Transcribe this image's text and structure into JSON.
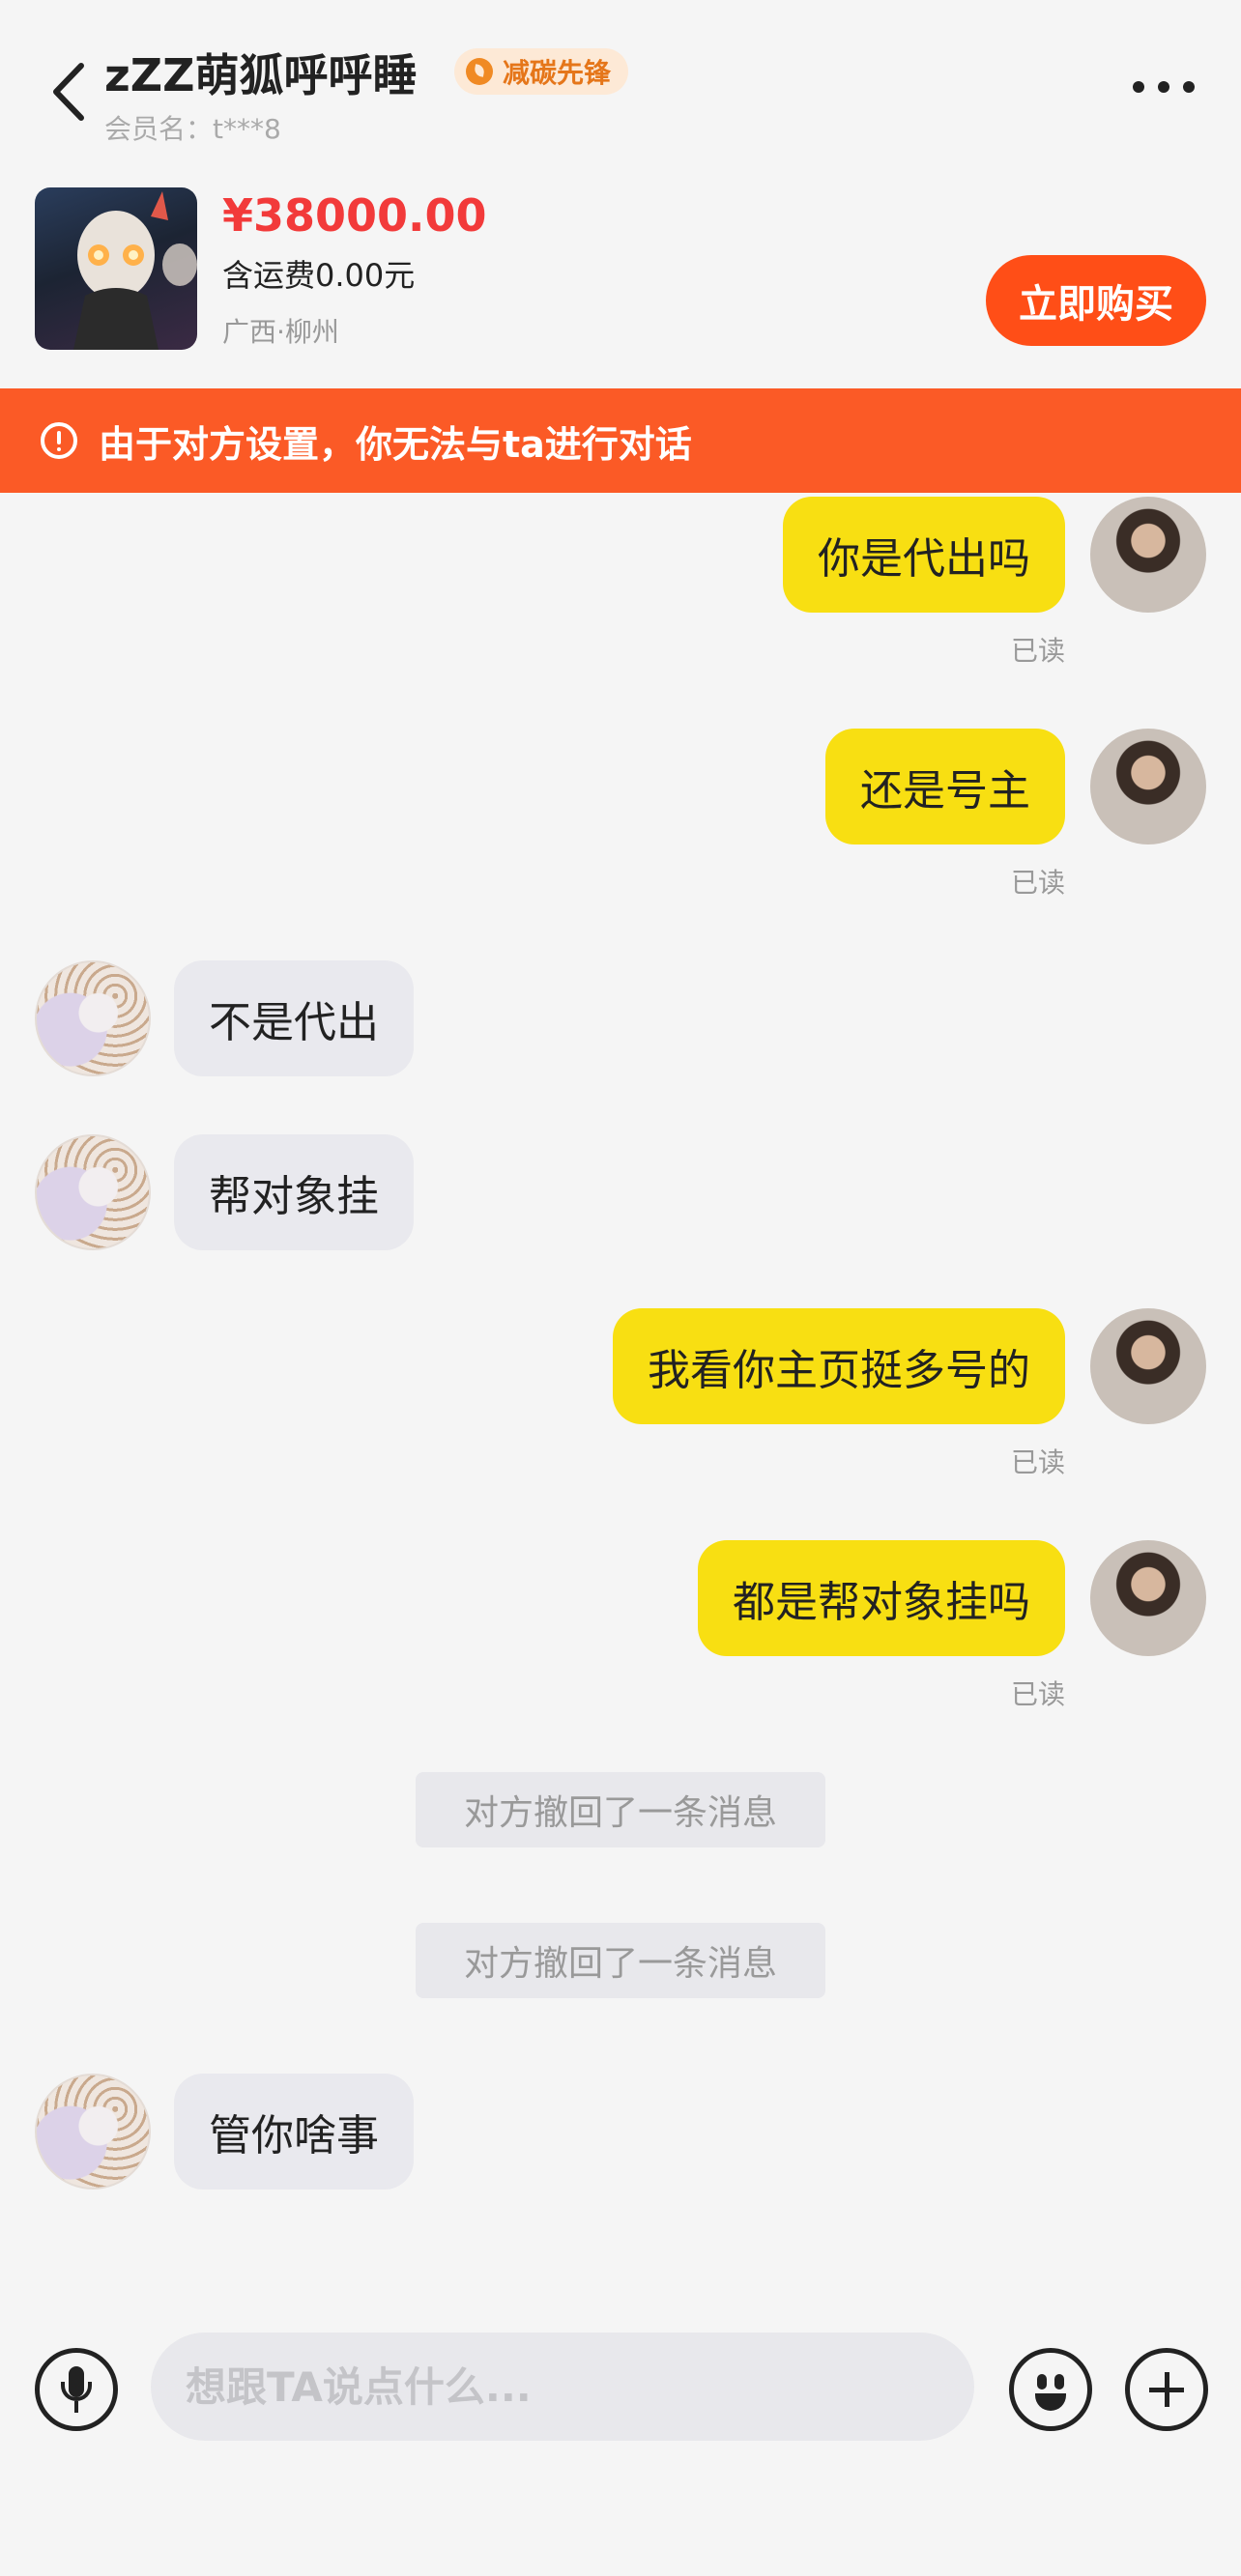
{
  "header": {
    "title": "zZZ萌狐呼呼睡",
    "badge": "减碳先锋",
    "member": "会员名：t***8"
  },
  "product": {
    "price": "¥38000.00",
    "shipping": "含运费0.00元",
    "location": "广西·柳州",
    "buy_label": "立即购买"
  },
  "warning": {
    "text": "由于对方设置，你无法与ta进行对话"
  },
  "messages": [
    {
      "from": "self",
      "text": "你是代出吗",
      "status": "已读"
    },
    {
      "from": "self",
      "text": "还是号主",
      "status": "已读"
    },
    {
      "from": "other",
      "text": "不是代出"
    },
    {
      "from": "other",
      "text": "帮对象挂"
    },
    {
      "from": "self",
      "text": "我看你主页挺多号的",
      "status": "已读"
    },
    {
      "from": "self",
      "text": "都是帮对象挂吗",
      "status": "已读"
    },
    {
      "from": "system",
      "text": "对方撤回了一条消息"
    },
    {
      "from": "system",
      "text": "对方撤回了一条消息"
    },
    {
      "from": "other",
      "text": "管你啥事"
    }
  ],
  "input": {
    "placeholder": "想跟TA说点什么..."
  },
  "icons": {
    "back": "chevron-left-icon",
    "more": "more-dots-icon",
    "warning": "exclamation-circle-icon",
    "mic": "microphone-icon",
    "emoji": "emoji-icon",
    "plus": "plus-icon"
  },
  "colors": {
    "accent": "#ff4e17",
    "price": "#f23a3a",
    "self_bubble": "#f8df12",
    "other_bubble": "#e9e9ee"
  }
}
